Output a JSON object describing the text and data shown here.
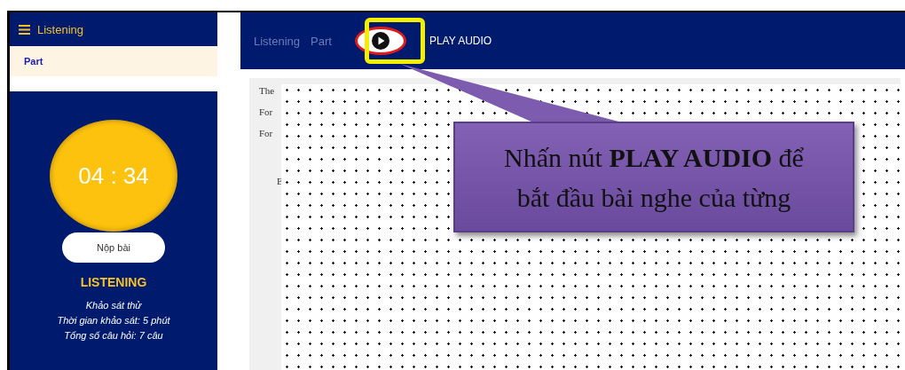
{
  "sidebar": {
    "title": "Listening",
    "items": [
      {
        "label": "Part",
        "selected": true
      }
    ],
    "timer": "04 : 34",
    "submit_button": "Nộp bài",
    "section_title": "LISTENING",
    "info": [
      "Khảo sát thử",
      "Thời gian khảo sát: 5 phút",
      "Tổng số câu hỏi: 7 câu"
    ]
  },
  "header": {
    "breadcrumb": [
      "Listening",
      "Part"
    ],
    "play_button": "PLAY AUDIO"
  },
  "content": {
    "lines": [
      "The",
      "For",
      "For"
    ],
    "caption": "E"
  },
  "callout": {
    "text": "Nhấn nút **PLAY AUDIO** để bắt đầu bài nghe của từng"
  }
}
